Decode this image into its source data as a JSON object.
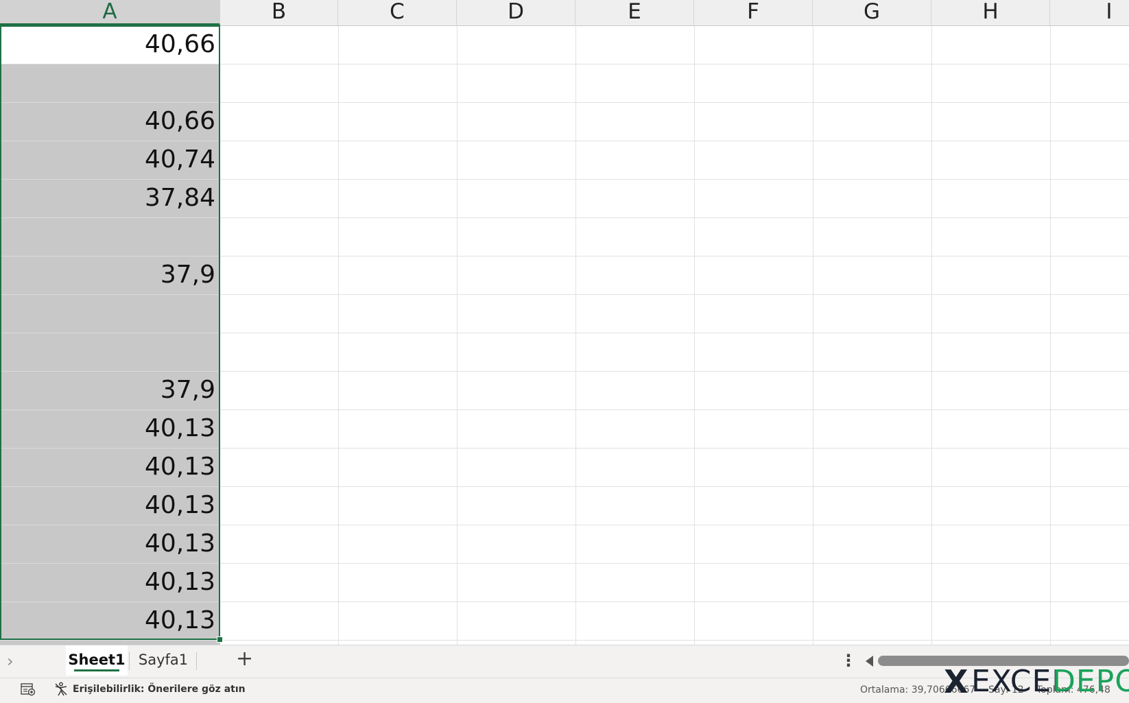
{
  "columns": [
    "A",
    "B",
    "C",
    "D",
    "E",
    "F",
    "G",
    "H",
    "I"
  ],
  "selected_column": "A",
  "cells_A": [
    "40,66",
    "",
    "40,66",
    "40,74",
    "37,84",
    "",
    "37,9",
    "",
    "",
    "37,9",
    "40,13",
    "40,13",
    "40,13",
    "40,13",
    "40,13",
    "40,13"
  ],
  "sheet_tabs": {
    "nav_glyph": "›",
    "tabs": [
      "Sheet1",
      "Sayfa1"
    ],
    "active": "Sheet1",
    "add_glyph": "+",
    "more_glyph": "⋮"
  },
  "status": {
    "accessibility": "Erişilebilirlik: Önerilere göz atın",
    "average": "Ortalama: 39,70666667",
    "count": "Say: 12",
    "sum": "Toplam: 476,48"
  },
  "watermark": {
    "x": "X",
    "excel": "EXCEL",
    "depo": "DEPO"
  },
  "colors": {
    "accent": "#1e7145",
    "selection_fill": "#c8c8c8",
    "watermark_green": "#1aa35a"
  }
}
